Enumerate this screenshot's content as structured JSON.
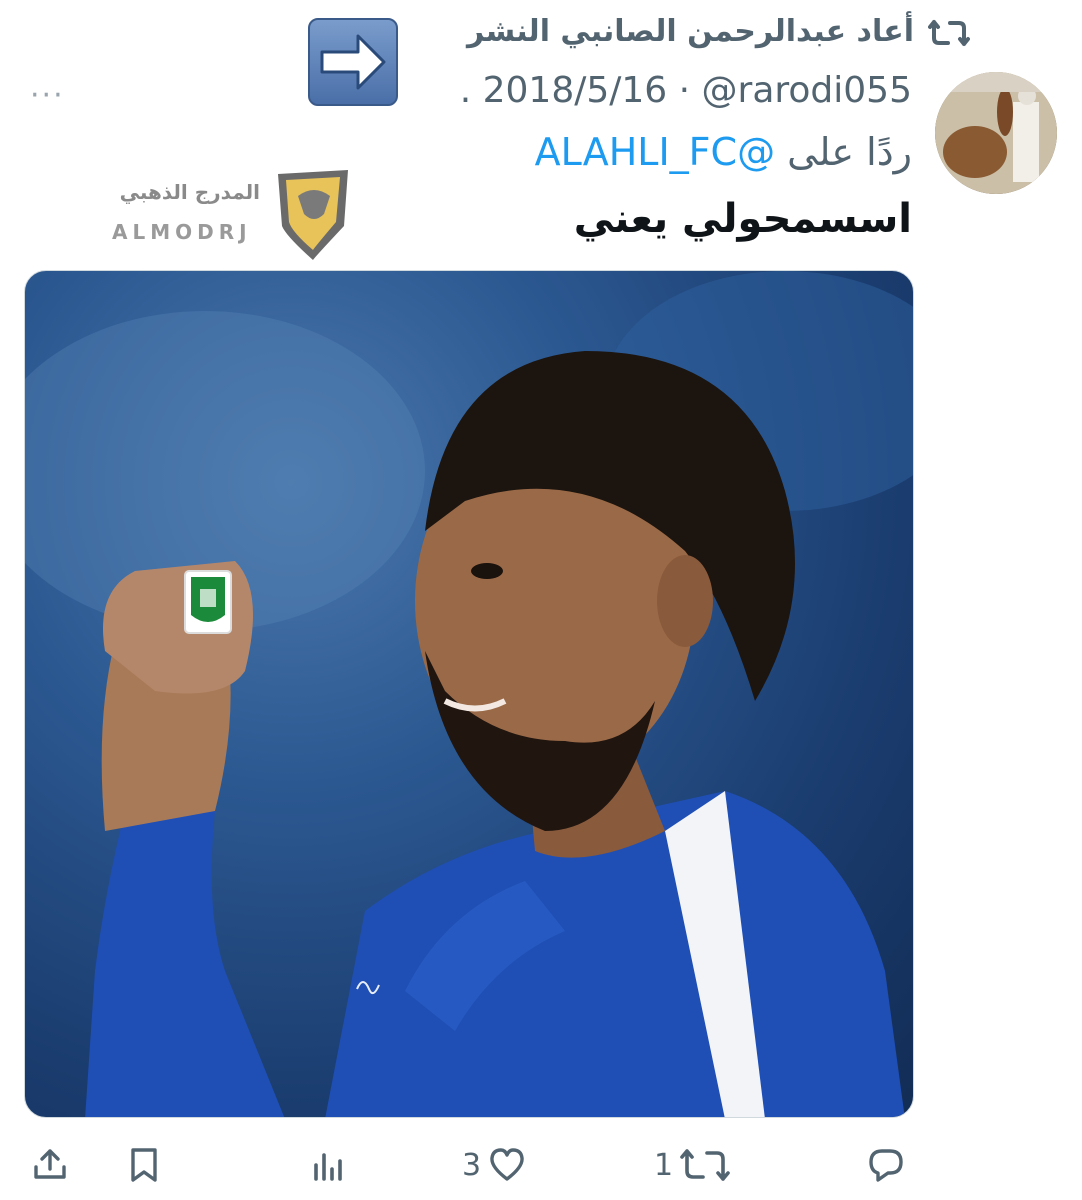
{
  "repost": {
    "label": "أعاد عبدالرحمن الصانبي النشر",
    "icon": "repost-icon"
  },
  "tweet": {
    "meta": ". 2018/5/16 · @rarodi055",
    "reply_prefix": "ردًا على",
    "reply_handle": "@ALAHLI_FC",
    "text": "اسسمحولي يعني"
  },
  "watermark": {
    "arabic": "المدرج الذهبي",
    "english": "ALMODRJ"
  },
  "more_menu": "···",
  "actions": {
    "reply_count": "",
    "repost_count": "1",
    "like_count": "3",
    "views_count": ""
  },
  "colors": {
    "muted": "#536471",
    "link": "#1d9bf0",
    "jersey_blue": "#1f4fb5",
    "badge_green": "#1b8a3a"
  }
}
